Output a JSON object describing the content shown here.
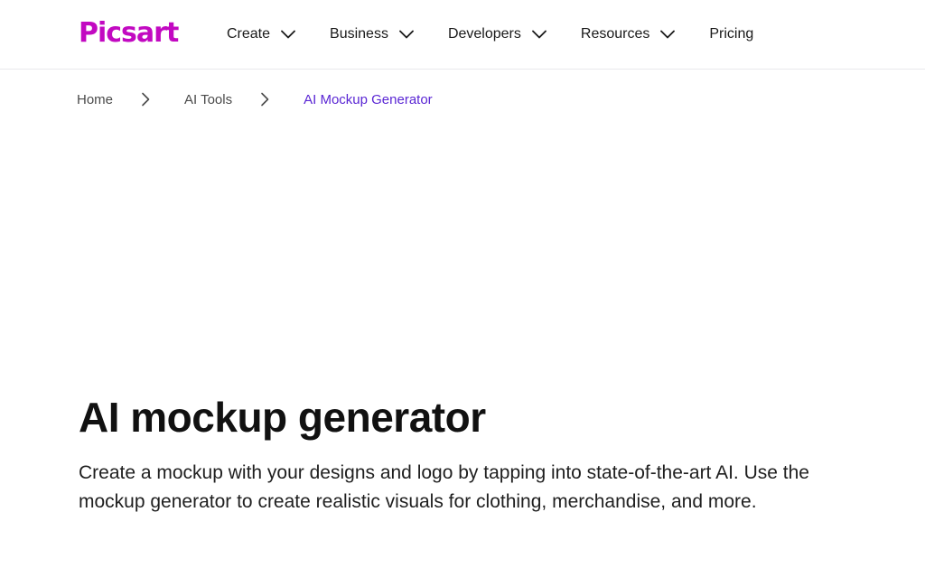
{
  "header": {
    "logo_text": "Picsart",
    "nav": [
      {
        "label": "Create",
        "has_dropdown": true
      },
      {
        "label": "Business",
        "has_dropdown": true
      },
      {
        "label": "Developers",
        "has_dropdown": true
      },
      {
        "label": "Resources",
        "has_dropdown": true
      },
      {
        "label": "Pricing",
        "has_dropdown": false
      }
    ]
  },
  "breadcrumb": {
    "items": [
      "Home",
      "AI Tools",
      "AI Mockup Generator"
    ]
  },
  "hero": {
    "title": "AI mockup generator",
    "description": "Create a mockup with your designs and logo by tapping into state-of-the-art AI. Use the mockup generator to create realistic visuals for clothing, merchandise, and more."
  },
  "colors": {
    "brand": "#c209c1",
    "breadcrumb_active": "#5a26d4",
    "text": "#1a1a1a",
    "divider": "#e8e8ec"
  },
  "icons": {
    "nav_dropdown": "chevron-down-icon",
    "breadcrumb_separator": "chevron-right-icon"
  }
}
